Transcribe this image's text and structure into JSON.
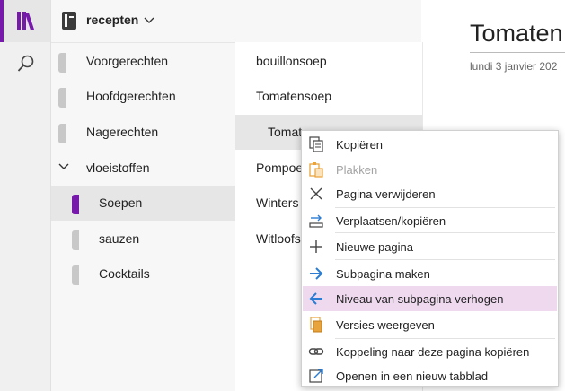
{
  "notebook": {
    "title": "recepten"
  },
  "sections": [
    {
      "label": "Voorgerechten"
    },
    {
      "label": "Hoofdgerechten"
    },
    {
      "label": "Nagerechten"
    },
    {
      "label": "vloeistoffen"
    },
    {
      "label": "Soepen"
    },
    {
      "label": "sauzen"
    },
    {
      "label": "Cocktails"
    }
  ],
  "pages": [
    {
      "label": "bouillonsoep"
    },
    {
      "label": "Tomatensoep"
    },
    {
      "label": "Tomat"
    },
    {
      "label": "Pompoe"
    },
    {
      "label": "Winters"
    },
    {
      "label": "Witloofs"
    }
  ],
  "canvas": {
    "title": "Tomaten",
    "date": "lundi 3 janvier 202"
  },
  "menu": {
    "items": [
      {
        "label": "Kopiëren",
        "icon": "copy-icon"
      },
      {
        "label": "Plakken",
        "icon": "paste-icon"
      },
      {
        "label": "Pagina verwijderen",
        "icon": "delete-x-icon"
      },
      {
        "label": "Verplaatsen/kopiëren",
        "icon": "move-icon"
      },
      {
        "label": "Nieuwe pagina",
        "icon": "plus-icon"
      },
      {
        "label": "Subpagina maken",
        "icon": "arrow-right-icon"
      },
      {
        "label": "Niveau van subpagina verhogen",
        "icon": "arrow-left-icon"
      },
      {
        "label": "Versies weergeven",
        "icon": "versions-icon"
      },
      {
        "label": "Koppeling naar deze pagina kopiëren",
        "icon": "link-icon"
      },
      {
        "label": "Openen in een nieuw tabblad",
        "icon": "open-tab-icon"
      }
    ]
  },
  "colors": {
    "accent": "#7719aa",
    "highlight": "#efd9ef",
    "arrow_blue": "#2b7cd3",
    "paste_orange": "#e8a33d"
  }
}
